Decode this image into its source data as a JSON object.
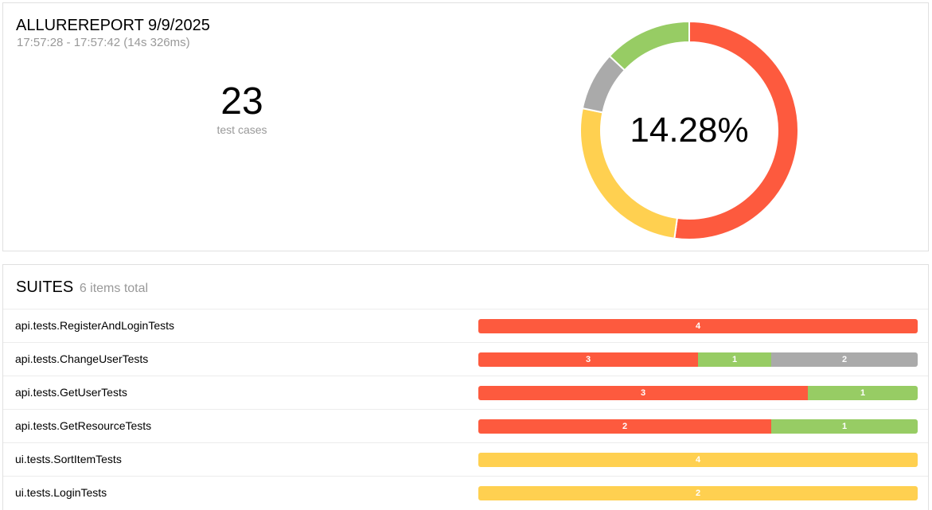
{
  "report": {
    "title": "ALLUREREPORT 9/9/2025",
    "time_range": "17:57:28 - 17:57:42 (14s 326ms)",
    "test_count": "23",
    "test_count_label": "test cases",
    "success_rate": "14.28%"
  },
  "colors": {
    "failed": "#fd5a3e",
    "broken": "#ffd050",
    "passed": "#97cc64",
    "skipped": "#aaaaaa"
  },
  "chart_data": {
    "type": "pie",
    "donut": true,
    "center_label": "14.28%",
    "segments": [
      {
        "status": "failed",
        "value": 12
      },
      {
        "status": "broken",
        "value": 6
      },
      {
        "status": "skipped",
        "value": 2
      },
      {
        "status": "passed",
        "value": 3
      }
    ]
  },
  "suites": {
    "title": "SUITES",
    "total_label": "6 items total",
    "rows": [
      {
        "name": "api.tests.RegisterAndLoginTests",
        "segments": [
          {
            "status": "failed",
            "value": 4
          }
        ]
      },
      {
        "name": "api.tests.ChangeUserTests",
        "segments": [
          {
            "status": "failed",
            "value": 3
          },
          {
            "status": "passed",
            "value": 1
          },
          {
            "status": "skipped",
            "value": 2
          }
        ]
      },
      {
        "name": "api.tests.GetUserTests",
        "segments": [
          {
            "status": "failed",
            "value": 3
          },
          {
            "status": "passed",
            "value": 1
          }
        ]
      },
      {
        "name": "api.tests.GetResourceTests",
        "segments": [
          {
            "status": "failed",
            "value": 2
          },
          {
            "status": "passed",
            "value": 1
          }
        ]
      },
      {
        "name": "ui.tests.SortItemTests",
        "segments": [
          {
            "status": "broken",
            "value": 4
          }
        ]
      },
      {
        "name": "ui.tests.LoginTests",
        "segments": [
          {
            "status": "broken",
            "value": 2
          }
        ]
      }
    ]
  }
}
